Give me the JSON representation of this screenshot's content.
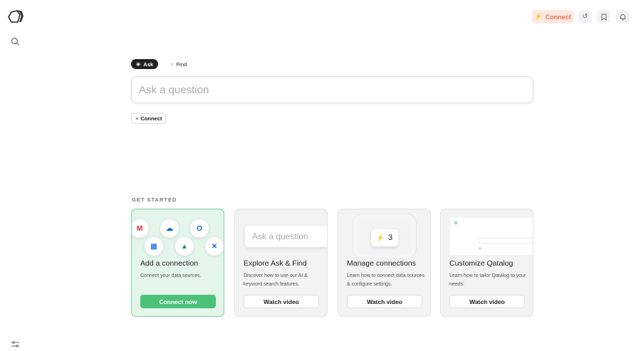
{
  "header": {
    "connect_label": "Connect",
    "history_icon": "history-icon",
    "bookmark_icon": "bookmark-icon",
    "bell_icon": "bell-icon"
  },
  "modes": [
    {
      "label": "Ask",
      "active": true
    },
    {
      "label": "Find",
      "active": false
    }
  ],
  "search": {
    "placeholder": "Ask a question"
  },
  "connect_chip": {
    "label": "Connect"
  },
  "get_started": {
    "heading": "GET STARTED",
    "cards": [
      {
        "title": "Add a connection",
        "desc": "Connect your data sources.",
        "button": "Connect now"
      },
      {
        "title": "Explore Ask & Find",
        "desc": "Discover how to use our AI & keyword search features.",
        "button": "Watch video",
        "preview_placeholder": "Ask a question"
      },
      {
        "title": "Manage connections",
        "desc": "Learn how to connect data sources & configure settings.",
        "button": "Watch video",
        "preview_count": "3"
      },
      {
        "title": "Customize Qatalog",
        "desc": "Learn how to tailor Qatalog to your needs.",
        "button": "Watch video"
      }
    ]
  },
  "colors": {
    "accent_orange": "#e5714a",
    "green": "#4cc17a"
  }
}
